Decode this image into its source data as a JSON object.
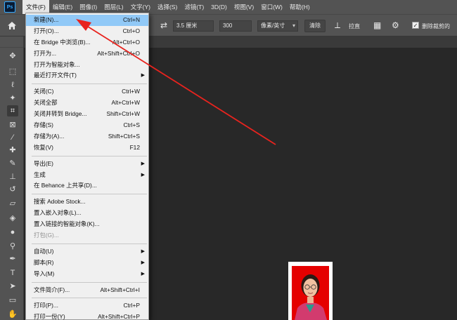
{
  "app": {
    "logo": "Ps"
  },
  "menubar": {
    "items": [
      "文件(F)",
      "编辑(E)",
      "图像(I)",
      "图层(L)",
      "文字(Y)",
      "选择(S)",
      "滤镜(T)",
      "3D(D)",
      "视图(V)",
      "窗口(W)",
      "帮助(H)"
    ]
  },
  "options": {
    "width_value": "",
    "height_value": "3.5 厘米",
    "resolution_value": "300",
    "unit_select": "像素/英寸",
    "clear_label": "清除",
    "straighten_label": "拉直",
    "delete_cropped_label": "删除裁剪的"
  },
  "file_menu": {
    "groups": [
      [
        {
          "label": "新建(N)...",
          "shortcut": "Ctrl+N",
          "highlighted": true
        },
        {
          "label": "打开(O)...",
          "shortcut": "Ctrl+O"
        },
        {
          "label": "在 Bridge 中浏览(B)...",
          "shortcut": "Alt+Ctrl+O"
        },
        {
          "label": "打开为...",
          "shortcut": "Alt+Shift+Ctrl+O"
        },
        {
          "label": "打开为智能对象..."
        },
        {
          "label": "最近打开文件(T)",
          "submenu": true
        }
      ],
      [
        {
          "label": "关闭(C)",
          "shortcut": "Ctrl+W"
        },
        {
          "label": "关闭全部",
          "shortcut": "Alt+Ctrl+W"
        },
        {
          "label": "关闭并转到 Bridge...",
          "shortcut": "Shift+Ctrl+W"
        },
        {
          "label": "存储(S)",
          "shortcut": "Ctrl+S"
        },
        {
          "label": "存储为(A)...",
          "shortcut": "Shift+Ctrl+S"
        },
        {
          "label": "恢复(V)",
          "shortcut": "F12"
        }
      ],
      [
        {
          "label": "导出(E)",
          "submenu": true
        },
        {
          "label": "生成",
          "submenu": true
        },
        {
          "label": "在 Behance 上共享(D)..."
        }
      ],
      [
        {
          "label": "搜索 Adobe Stock..."
        },
        {
          "label": "置入嵌入对象(L)..."
        },
        {
          "label": "置入链接的智能对象(K)..."
        },
        {
          "label": "打包(G)...",
          "disabled": true
        }
      ],
      [
        {
          "label": "自动(U)",
          "submenu": true
        },
        {
          "label": "脚本(R)",
          "submenu": true
        },
        {
          "label": "导入(M)",
          "submenu": true
        }
      ],
      [
        {
          "label": "文件简介(F)...",
          "shortcut": "Alt+Shift+Ctrl+I"
        }
      ],
      [
        {
          "label": "打印(P)...",
          "shortcut": "Ctrl+P"
        },
        {
          "label": "打印一份(Y)",
          "shortcut": "Alt+Shift+Ctrl+P"
        }
      ]
    ]
  },
  "tools": [
    {
      "name": "move-tool-icon",
      "glyph": "✥"
    },
    {
      "name": "marquee-tool-icon",
      "glyph": "⬚"
    },
    {
      "name": "lasso-tool-icon",
      "glyph": "ℓ"
    },
    {
      "name": "magic-wand-tool-icon",
      "glyph": "✦"
    },
    {
      "name": "crop-tool-icon",
      "glyph": "⌗"
    },
    {
      "name": "frame-tool-icon",
      "glyph": "⊠"
    },
    {
      "name": "eyedropper-tool-icon",
      "glyph": "⁄"
    },
    {
      "name": "healing-brush-tool-icon",
      "glyph": "✚"
    },
    {
      "name": "brush-tool-icon",
      "glyph": "✎"
    },
    {
      "name": "clone-stamp-tool-icon",
      "glyph": "⊥"
    },
    {
      "name": "history-brush-tool-icon",
      "glyph": "↺"
    },
    {
      "name": "eraser-tool-icon",
      "glyph": "▱"
    },
    {
      "name": "paint-bucket-tool-icon",
      "glyph": "◈"
    },
    {
      "name": "blur-tool-icon",
      "glyph": "●"
    },
    {
      "name": "dodge-tool-icon",
      "glyph": "⚲"
    },
    {
      "name": "pen-tool-icon",
      "glyph": "✒"
    },
    {
      "name": "type-tool-icon",
      "glyph": "T"
    },
    {
      "name": "path-selection-tool-icon",
      "glyph": "➤"
    },
    {
      "name": "rectangle-tool-icon",
      "glyph": "▭"
    },
    {
      "name": "hand-tool-icon",
      "glyph": "✋"
    }
  ],
  "colors": {
    "menu_highlight": "#91c9f7",
    "annotation_arrow": "#e8231e",
    "photo_background": "#e50000"
  }
}
